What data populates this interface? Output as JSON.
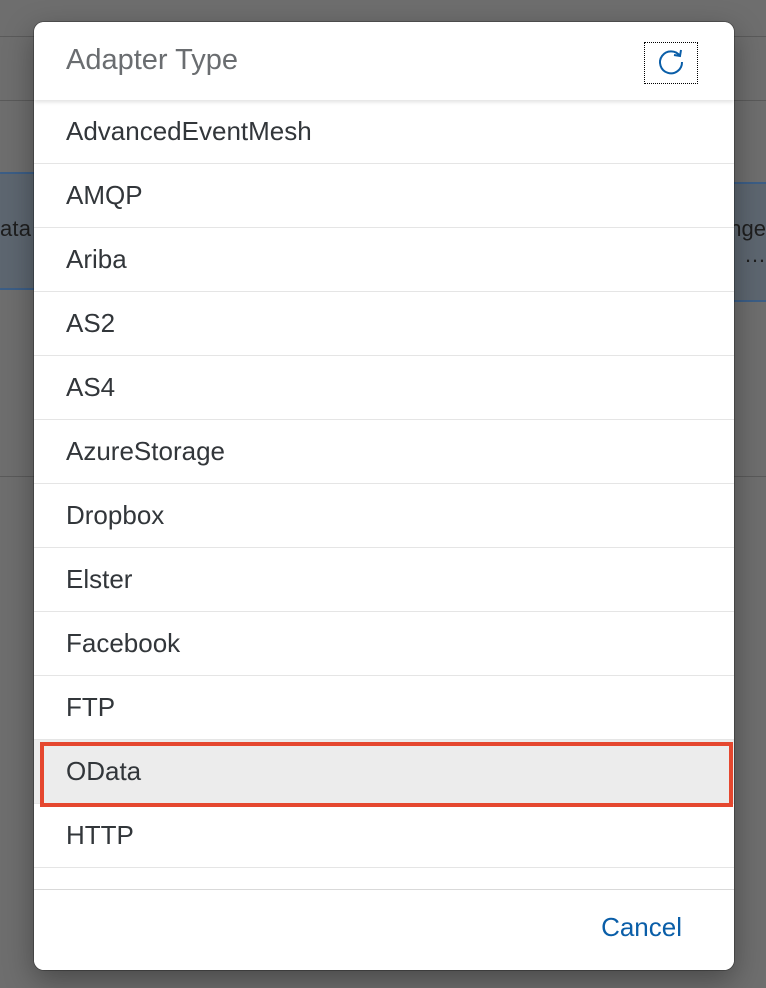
{
  "background": {
    "left_text": "ata",
    "right_text_line1": "nge",
    "right_text_line2": "…"
  },
  "dialog": {
    "title": "Adapter Type",
    "refresh_icon": "refresh-icon",
    "items": [
      {
        "label": "AdvancedEventMesh"
      },
      {
        "label": "AMQP"
      },
      {
        "label": "Ariba"
      },
      {
        "label": "AS2"
      },
      {
        "label": "AS4"
      },
      {
        "label": "AzureStorage"
      },
      {
        "label": "Dropbox"
      },
      {
        "label": "Elster"
      },
      {
        "label": "Facebook"
      },
      {
        "label": "FTP"
      },
      {
        "label": "OData"
      },
      {
        "label": "HTTP"
      }
    ],
    "selected_item": "OData",
    "cancel_label": "Cancel"
  },
  "colors": {
    "accent": "#0a5ea8",
    "highlight": "#e5472f",
    "selected_row": "#ececec",
    "overlay": "#6e6e6e"
  }
}
